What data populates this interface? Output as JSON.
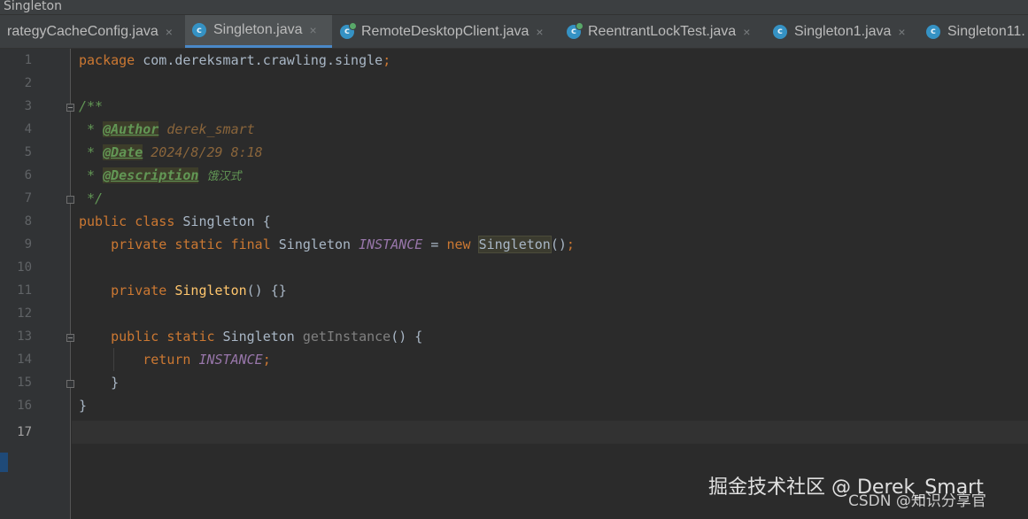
{
  "window": {
    "title": "Singleton"
  },
  "tabs": [
    {
      "label": "rategyCacheConfig.java",
      "close": "×",
      "icon": "none",
      "active": false
    },
    {
      "label": "Singleton.java",
      "close": "×",
      "icon": "c",
      "active": true
    },
    {
      "label": "RemoteDesktopClient.java",
      "close": "×",
      "icon": "c-modified",
      "active": false
    },
    {
      "label": "ReentrantLockTest.java",
      "close": "×",
      "icon": "c-modified",
      "active": false
    },
    {
      "label": "Singleton1.java",
      "close": "×",
      "icon": "c",
      "active": false
    },
    {
      "label": "Singleton11.",
      "icon": "c",
      "active": false
    }
  ],
  "tab_icon_letter": "c",
  "line_numbers": [
    "1",
    "2",
    "3",
    "4",
    "5",
    "6",
    "7",
    "8",
    "9",
    "10",
    "11",
    "12",
    "13",
    "14",
    "15",
    "16",
    "17"
  ],
  "current_line": "17",
  "code": {
    "l1": {
      "kw": "package",
      "pkg": " com.dereksmart.crawling.single",
      "semi": ";"
    },
    "l3": {
      "doc": "/**"
    },
    "l4": {
      "star": " * ",
      "tag": "@Author",
      "val": " derek_smart"
    },
    "l5": {
      "star": " * ",
      "tag": "@Date",
      "val": " 2024/8/29 8:18"
    },
    "l6": {
      "star": " * ",
      "tag": "@Description",
      "val": "饿汉式"
    },
    "l7": {
      "doc": " */"
    },
    "l8": {
      "kw": "public class",
      "rest": " Singleton {"
    },
    "l9": {
      "indent": "    ",
      "kw": "private static final",
      "type": " Singleton ",
      "const": "INSTANCE",
      "eq": " = ",
      "new": "new",
      "sp": " ",
      "hl": "Singleton",
      "end": "()",
      "semi": ";"
    },
    "l11": {
      "indent": "    ",
      "kw": "private",
      "sp": " ",
      "meth": "Singleton",
      "rest": "() {}"
    },
    "l13": {
      "indent": "    ",
      "kw": "public static",
      "type": " Singleton ",
      "meth": "getInstance",
      "rest": "() {"
    },
    "l14": {
      "indent": "        ",
      "kw": "return",
      "sp": " ",
      "const": "INSTANCE",
      "semi": ";"
    },
    "l15": {
      "rest": "    }"
    },
    "l16": {
      "rest": "}"
    }
  },
  "watermark": {
    "line1": "掘金技术社区 @ Derek_Smart",
    "line2": "CSDN @知识分享官"
  },
  "colors": {
    "keyword": "#cc7832",
    "doc": "#629755",
    "constant": "#9876aa",
    "method": "#ffc66d",
    "text": "#a9b7c6",
    "background": "#2b2b2b",
    "tab_active_underline": "#4a88c7"
  }
}
